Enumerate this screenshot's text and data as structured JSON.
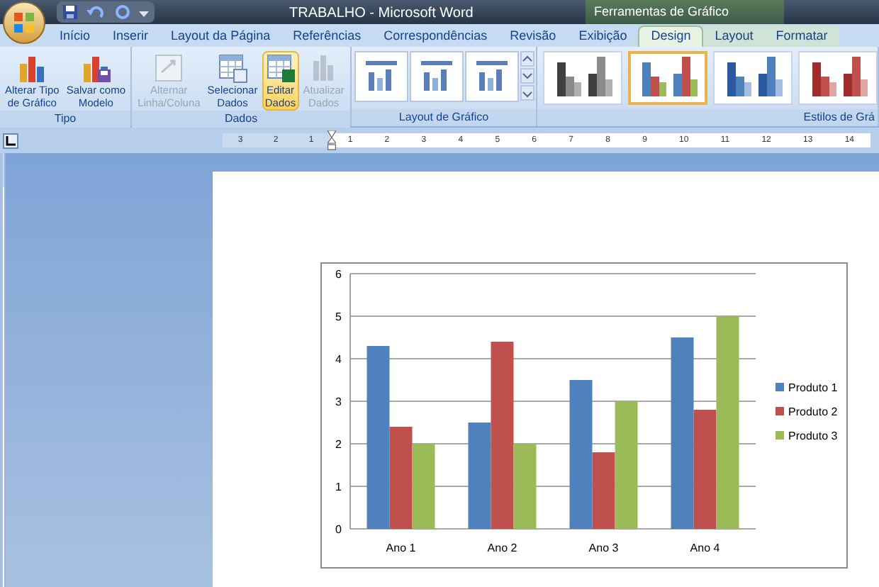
{
  "window": {
    "title": "TRABALHO - Microsoft Word",
    "context_title": "Ferramentas de Gráfico"
  },
  "tabs": [
    {
      "label": "Início",
      "selected": false,
      "contextual": false
    },
    {
      "label": "Inserir",
      "selected": false,
      "contextual": false
    },
    {
      "label": "Layout da Página",
      "selected": false,
      "contextual": false
    },
    {
      "label": "Referências",
      "selected": false,
      "contextual": false
    },
    {
      "label": "Correspondências",
      "selected": false,
      "contextual": false
    },
    {
      "label": "Revisão",
      "selected": false,
      "contextual": false
    },
    {
      "label": "Exibição",
      "selected": false,
      "contextual": false
    },
    {
      "label": "Design",
      "selected": true,
      "contextual": true
    },
    {
      "label": "Layout",
      "selected": false,
      "contextual": true
    },
    {
      "label": "Formatar",
      "selected": false,
      "contextual": true
    }
  ],
  "ribbon": {
    "groups": [
      {
        "label": "Tipo",
        "kind": "buttons",
        "buttons": [
          {
            "lines": [
              "Alterar Tipo",
              "de Gráfico"
            ],
            "kind": "chart",
            "disabled": false,
            "highlighted": false
          },
          {
            "lines": [
              "Salvar como",
              "Modelo"
            ],
            "kind": "save-chart",
            "disabled": false,
            "highlighted": false
          }
        ]
      },
      {
        "label": "Dados",
        "kind": "buttons",
        "buttons": [
          {
            "lines": [
              "Alternar",
              "Linha/Coluna"
            ],
            "kind": "switch",
            "disabled": true,
            "highlighted": false
          },
          {
            "lines": [
              "Selecionar",
              "Dados"
            ],
            "kind": "select",
            "disabled": false,
            "highlighted": false
          },
          {
            "lines": [
              "Editar",
              "Dados"
            ],
            "kind": "edit",
            "disabled": false,
            "highlighted": true
          },
          {
            "lines": [
              "Atualizar",
              "Dados"
            ],
            "kind": "refresh",
            "disabled": true,
            "highlighted": false
          }
        ]
      },
      {
        "label": "Layout de Gráfico",
        "kind": "layouts",
        "items": [
          {
            "selected": false
          },
          {
            "selected": false
          },
          {
            "selected": false
          }
        ]
      },
      {
        "label": "Estilos de Grá",
        "kind": "styles",
        "items": [
          {
            "kind": "gray",
            "selected": false
          },
          {
            "kind": "multi",
            "selected": true
          },
          {
            "kind": "blue",
            "selected": false
          },
          {
            "kind": "red",
            "selected": false
          }
        ]
      }
    ]
  },
  "ruler": {
    "left_numbers": [
      "3",
      "2",
      "1"
    ],
    "numbers": [
      "1",
      "2",
      "3",
      "4",
      "5",
      "6",
      "7",
      "8",
      "9",
      "10",
      "11",
      "12",
      "13",
      "14"
    ]
  },
  "document": {
    "chart_data": {
      "type": "bar",
      "categories": [
        "Ano 1",
        "Ano 2",
        "Ano 3",
        "Ano 4"
      ],
      "series": [
        {
          "name": "Produto 1",
          "color": "#4f81bd",
          "values": [
            4.3,
            2.5,
            3.5,
            4.5
          ]
        },
        {
          "name": "Produto 2",
          "color": "#c0504d",
          "values": [
            2.4,
            4.4,
            1.8,
            2.8
          ]
        },
        {
          "name": "Produto 3",
          "color": "#9bbb59",
          "values": [
            2,
            2,
            3,
            5
          ]
        }
      ],
      "ylim": [
        0,
        6
      ],
      "yticks": [
        0,
        1,
        2,
        3,
        4,
        5,
        6
      ],
      "grid": true,
      "legend": true
    }
  }
}
